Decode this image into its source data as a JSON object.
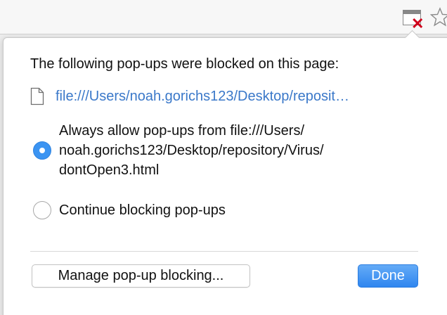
{
  "toolbar": {
    "popup_blocked_icon": "popup-blocked-icon",
    "bookmark_icon": "star-outline-icon"
  },
  "bubble": {
    "heading": "The following pop-ups were blocked on this page:",
    "blocked_items": [
      {
        "icon": "file-icon",
        "url": "file:///Users/noah.gorichs123/Desktop/reposit…"
      }
    ],
    "options": [
      {
        "lines": [
          "Always allow pop-ups from file:///Users/",
          "noah.gorichs123/Desktop/repository/Virus/",
          "dontOpen3.html"
        ],
        "selected": true
      },
      {
        "lines": [
          "Continue blocking pop-ups"
        ],
        "selected": false
      }
    ],
    "manage_label": "Manage pop-up blocking...",
    "done_label": "Done"
  },
  "colors": {
    "link": "#3a78c9",
    "accent": "#3b94f2",
    "blocked_x": "#d0021b"
  }
}
